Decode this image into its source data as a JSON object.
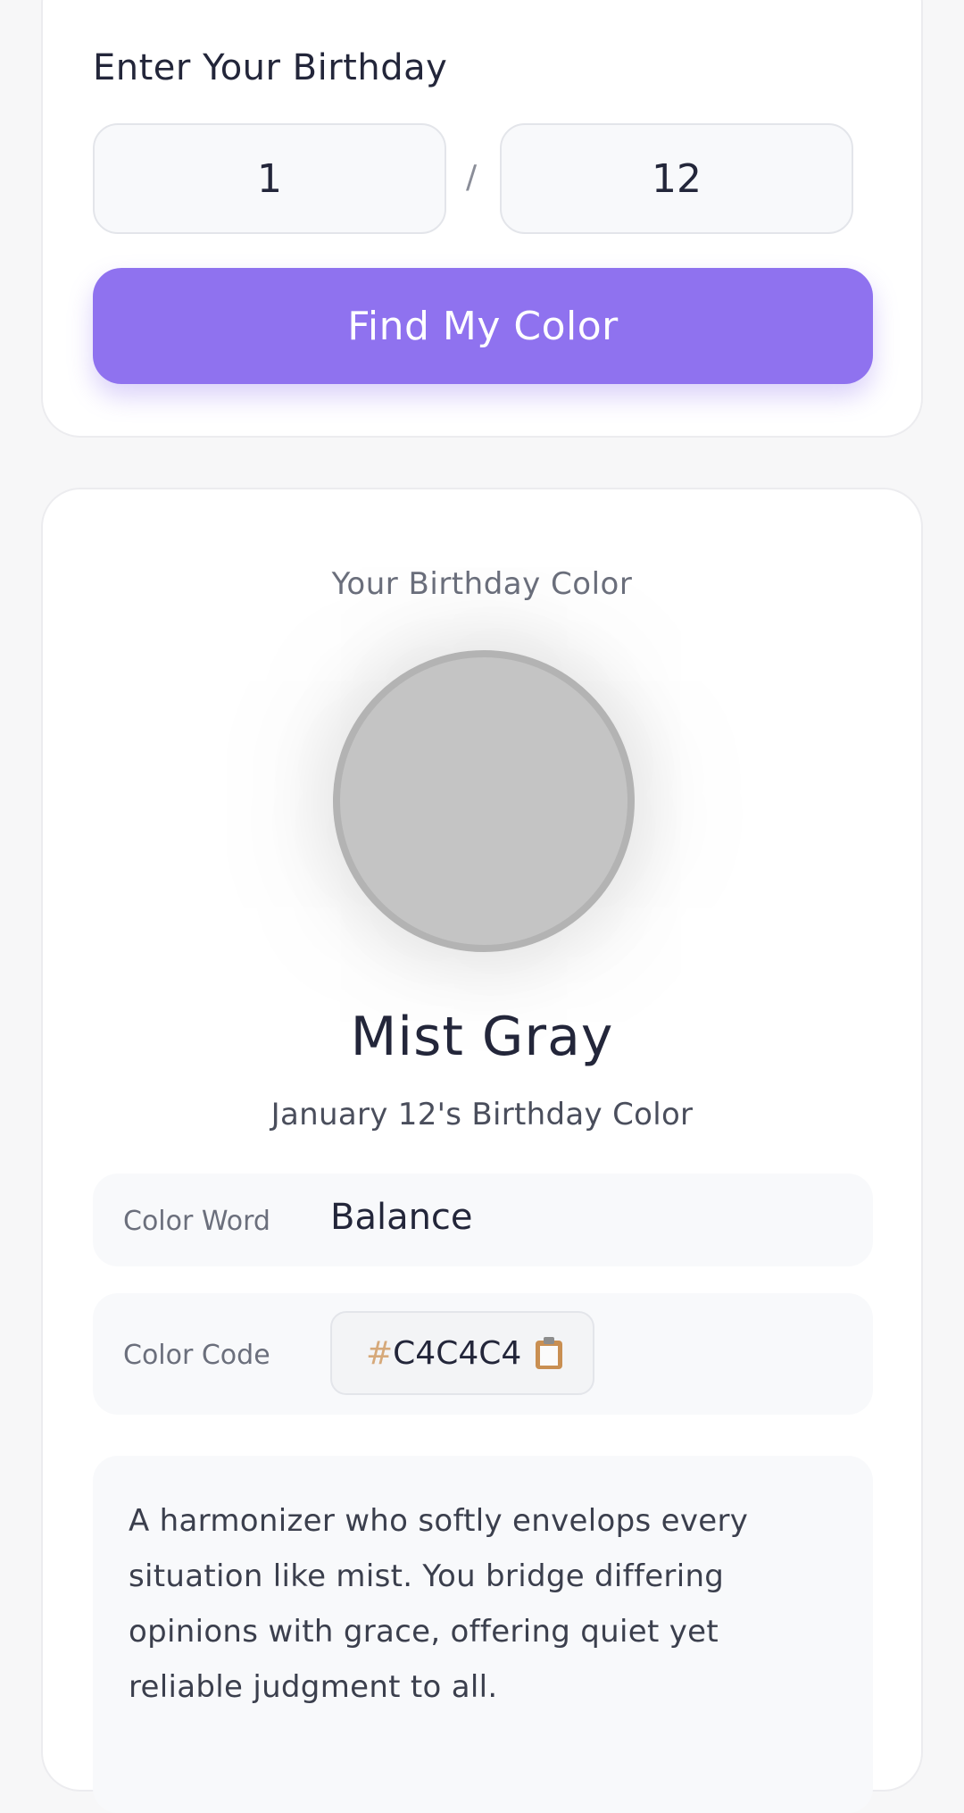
{
  "input_section": {
    "title": "Enter Your Birthday",
    "month_value": "1",
    "separator": "/",
    "day_value": "12",
    "button_label": "Find My Color"
  },
  "result": {
    "label": "Your Birthday Color",
    "swatch_color": "#C4C4C4",
    "color_name": "Mist Gray",
    "subtitle": "January 12's Birthday Color",
    "color_word_label": "Color Word",
    "color_word_value": "Balance",
    "color_code_label": "Color Code",
    "color_code_hash": "#",
    "color_code_value": "C4C4C4",
    "copy_icon": "clipboard-icon",
    "description": "A harmonizer who softly envelops every situation like mist. You bridge differing opinions with grace, offering quiet yet reliable judgment to all."
  },
  "colors": {
    "accent": "#8F72EF",
    "background": "#F7F7F8"
  }
}
